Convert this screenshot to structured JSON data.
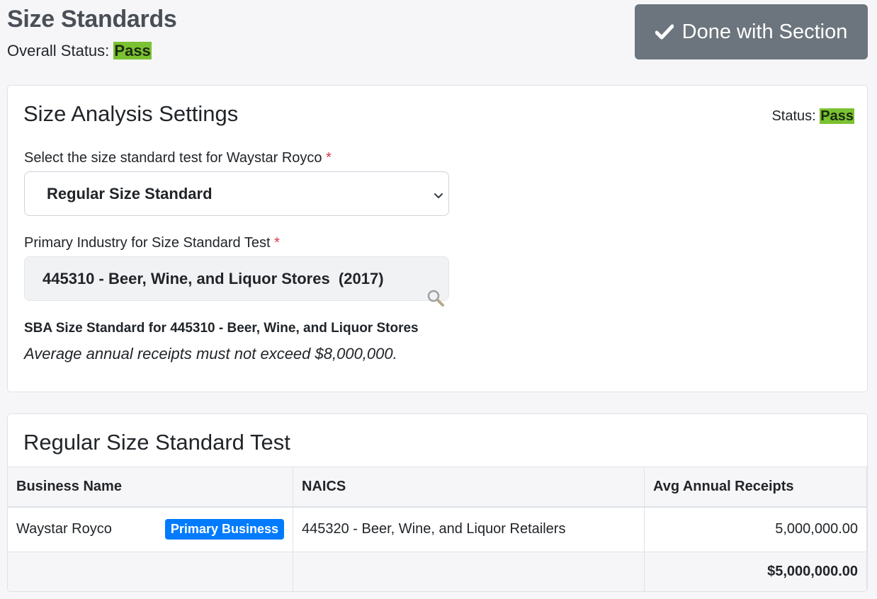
{
  "header": {
    "title": "Size Standards",
    "overall_status_label": "Overall Status:",
    "overall_status_value": "Pass",
    "done_button_label": "Done with Section"
  },
  "settings": {
    "title": "Size Analysis Settings",
    "status_label": "Status:",
    "status_value": "Pass",
    "test_select_label": "Select the size standard test for Waystar Royco",
    "test_select_value": "Regular Size Standard",
    "industry_label": "Primary Industry for Size Standard Test",
    "industry_value": "445310 - Beer, Wine, and Liquor Stores  (2017)",
    "required_marker": "*",
    "sba_title": "SBA Size Standard for 445310 - Beer, Wine, and Liquor Stores",
    "sba_note": "Average annual receipts must not exceed $8,000,000."
  },
  "test": {
    "title": "Regular Size Standard Test",
    "columns": [
      "Business Name",
      "NAICS",
      "Avg Annual Receipts"
    ],
    "rows": [
      {
        "business_name": "Waystar Royco",
        "badge": "Primary Business",
        "naics": "445320 - Beer, Wine, and Liquor Retailers",
        "avg_receipts": "5,000,000.00"
      }
    ],
    "total": "$5,000,000.00"
  },
  "colors": {
    "pass": "#7ac231",
    "button": "#6c757d",
    "badge": "#007bff",
    "required": "#dc3545"
  },
  "icons": {
    "done_button": "check-icon",
    "select": "chevron-down-icon",
    "search": "search-icon"
  }
}
